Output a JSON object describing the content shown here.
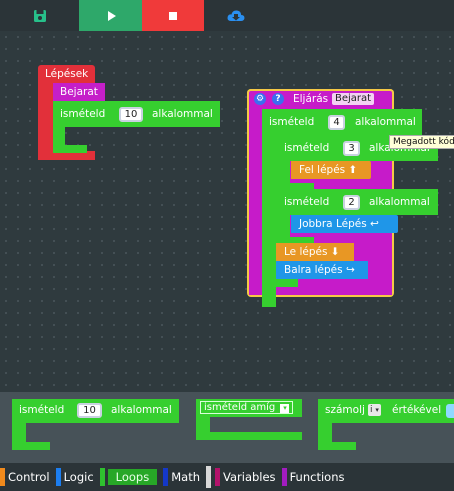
{
  "toolbar": {
    "save_icon": "floppy-disk-icon",
    "run_icon": "play-icon",
    "stop_icon": "stop-icon",
    "download_icon": "cloud-download-icon",
    "colors": {
      "save": "#27c08a",
      "run": "#2ea86a",
      "stop": "#f03a3a",
      "download": "#2a8ff0"
    }
  },
  "workspace": {
    "steps_block": {
      "title": "Lépések",
      "call_label": "Bejarat",
      "repeat_prefix": "ismételd",
      "repeat_count": "10",
      "repeat_suffix": "alkalommal"
    },
    "procedure_block": {
      "header_label": "Eljárás",
      "name": "Bejarat",
      "outer_repeat": {
        "prefix": "ismételd",
        "count": "4",
        "suffix": "alkalommal"
      },
      "inner_repeat_1": {
        "prefix": "ismételd",
        "count": "3",
        "suffix": "alkalommal"
      },
      "up_step": "Fel  lépés  ⬆",
      "inner_repeat_2": {
        "prefix": "ismételd",
        "count": "2",
        "suffix": "alkalommal"
      },
      "right_step": "Jobbra  Lépés  ↩",
      "down_step": "Le  lépés  ⬇",
      "left_step": "Balra  lépés  ↪"
    },
    "tooltip": "Megadott kódr"
  },
  "flyout": {
    "repeat_block": {
      "prefix": "ismételd",
      "count": "10",
      "suffix": "alkalommal"
    },
    "while_block": {
      "label": "ismételd  amíg"
    },
    "count_block": {
      "prefix": "számolj",
      "var": "i",
      "suffix": "értékével"
    }
  },
  "categories": [
    {
      "label": "Control",
      "color": "#f08a1c"
    },
    {
      "label": "Logic",
      "color": "#1c7ef0"
    },
    {
      "label": "Loops",
      "color": "#2fc02f",
      "selected": true
    },
    {
      "label": "Math",
      "color": "#1438c8"
    },
    {
      "label": "Variables",
      "color": "#b2126a"
    },
    {
      "label": "Functions",
      "color": "#a21cc0"
    }
  ]
}
